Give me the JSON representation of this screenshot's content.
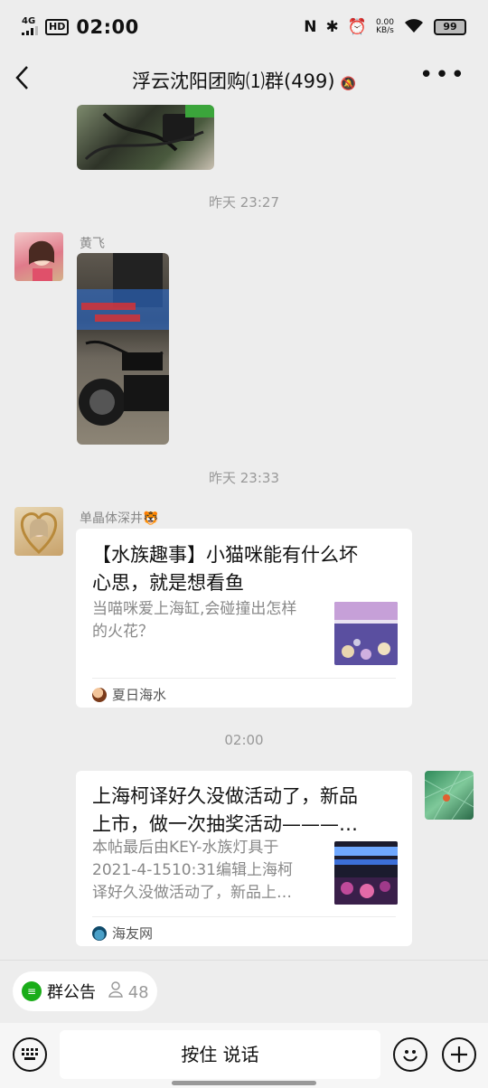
{
  "status_bar": {
    "network": "4G",
    "hd": "HD",
    "time": "02:00",
    "net_speed_value": "0.00",
    "net_speed_unit": "KB/s",
    "battery": "99"
  },
  "header": {
    "title": "浮云沈阳团购⑴群(499)"
  },
  "messages": {
    "ts1": "昨天 23:27",
    "sender1": "黄飞",
    "ts2": "昨天 23:33",
    "sender2": "单晶体深井🐯",
    "card1": {
      "title_line1": "【水族趣事】小猫咪能有什么坏",
      "title_line2": "心思，就是想看鱼",
      "desc_line1": "当喵咪爱上海缸,会碰撞出怎样",
      "desc_line2": "的火花？",
      "source": "夏日海水"
    },
    "ts3": "02:00",
    "card2": {
      "title_line1": "上海柯译好久没做活动了，新品",
      "title_line2": "上市，做一次抽奖活动———…",
      "desc_line1": "本帖最后由KEY-水族灯具于",
      "desc_line2": "2021-4-1510:31编辑上海柯",
      "desc_line3": "译好久没做活动了，新品上…",
      "source": "海友网"
    }
  },
  "notice": {
    "label": "群公告",
    "count": "48"
  },
  "input_bar": {
    "voice_label": "按住 说话"
  }
}
